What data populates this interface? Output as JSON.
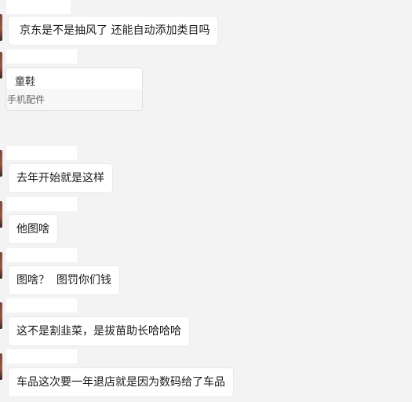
{
  "chat": {
    "messages": [
      {
        "text": "京东是不是抽风了 还能自动添加类目吗"
      },
      {
        "card_title": "童鞋",
        "card_subtitle": "手机配件"
      },
      {
        "text": "去年开始就是这样"
      },
      {
        "text": "他图啥"
      },
      {
        "text": "图啥？  图罚你们钱"
      },
      {
        "text": "这不是割韭菜，是拔苗助长哈哈哈"
      },
      {
        "text": "车品这次要一年退店就是因为数码给了车品"
      }
    ]
  }
}
